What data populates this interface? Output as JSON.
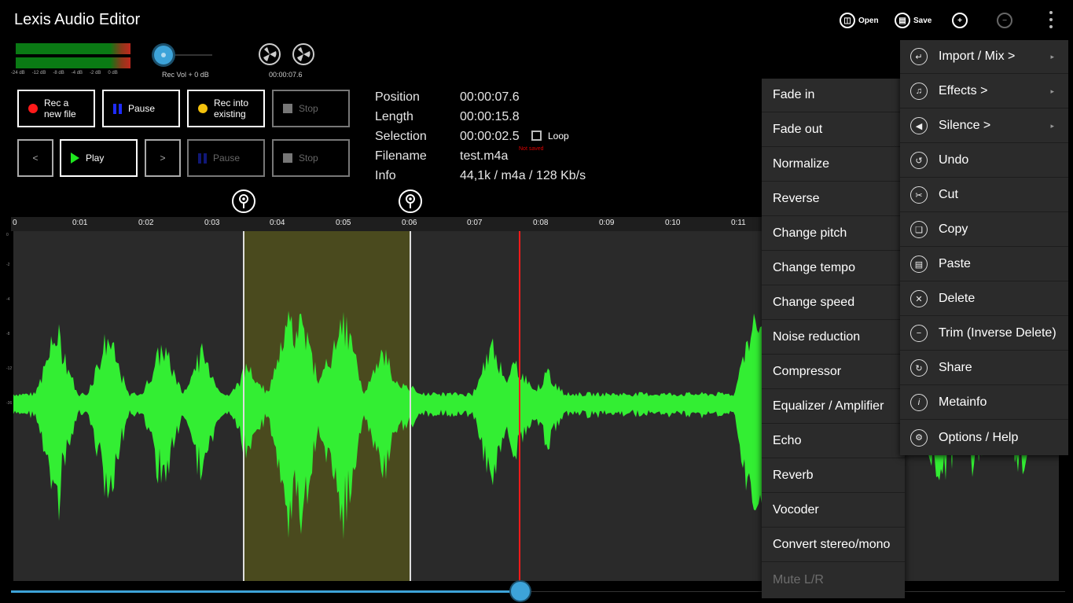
{
  "app": {
    "title": "Lexis Audio Editor"
  },
  "toolbar": {
    "open_label": "Open",
    "save_label": "Save"
  },
  "meters": {
    "db_scale": [
      "-24 dB",
      "-12 dB",
      "-8 dB",
      "-4 dB",
      "-2 dB",
      "0 dB"
    ],
    "rec_vol_label": "Rec Vol + 0 dB",
    "reel_time": "00:00:07.6"
  },
  "transport": {
    "rec_new": "Rec a\nnew file",
    "pause_rec": "Pause",
    "rec_existing": "Rec into\nexisting",
    "stop_rec": "Stop",
    "prev": "<",
    "play": "Play",
    "next": ">",
    "pause_play": "Pause",
    "stop_play": "Stop"
  },
  "info": {
    "position_label": "Position",
    "position_value": "00:00:07.6",
    "length_label": "Length",
    "length_value": "00:00:15.8",
    "selection_label": "Selection",
    "selection_value": "00:00:02.5",
    "loop_label": "Loop",
    "filename_label": "Filename",
    "filename_value": "test.m4a",
    "not_saved": "Not saved",
    "info_label": "Info",
    "info_value": "44,1k / m4a / 128 Kb/s"
  },
  "timeline": {
    "ticks": [
      "0",
      "0:01",
      "0:02",
      "0:03",
      "0:04",
      "0:05",
      "0:06",
      "0:07",
      "0:08",
      "0:09",
      "0:10",
      "0:11"
    ],
    "db_labels": [
      "0",
      "-2",
      "-4",
      "-8",
      "-12",
      "-36"
    ],
    "playhead_position": "00:00:07.6",
    "selection_start": "0:03.5",
    "selection_end": "0:06.0"
  },
  "colors": {
    "waveform": "#33ee33",
    "selection": "#4a4a1e",
    "playhead": "#ff1a1a",
    "accent": "#3da3d9"
  },
  "effects_menu": {
    "items": [
      "Fade in",
      "Fade out",
      "Normalize",
      "Reverse",
      "Change pitch",
      "Change tempo",
      "Change speed",
      "Noise reduction",
      "Compressor",
      "Equalizer / Amplifier",
      "Echo",
      "Reverb",
      "Vocoder",
      "Convert stereo/mono",
      "Mute L/R"
    ]
  },
  "main_menu": {
    "items": [
      {
        "label": "Import / Mix >",
        "icon": "import-icon"
      },
      {
        "label": "Effects >",
        "icon": "effects-icon"
      },
      {
        "label": "Silence >",
        "icon": "silence-icon"
      },
      {
        "label": "Undo",
        "icon": "undo-icon"
      },
      {
        "label": "Cut",
        "icon": "cut-icon"
      },
      {
        "label": "Copy",
        "icon": "copy-icon"
      },
      {
        "label": "Paste",
        "icon": "paste-icon"
      },
      {
        "label": "Delete",
        "icon": "delete-icon"
      },
      {
        "label": "Trim (Inverse Delete)",
        "icon": "trim-icon"
      },
      {
        "label": "Share",
        "icon": "share-icon"
      },
      {
        "label": "Metainfo",
        "icon": "info-icon"
      },
      {
        "label": "Options / Help",
        "icon": "gear-icon"
      }
    ]
  }
}
